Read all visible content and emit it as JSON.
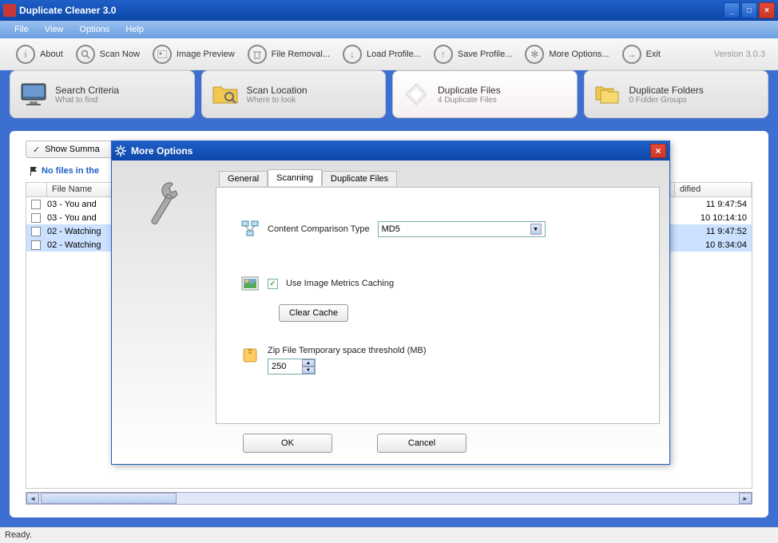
{
  "app": {
    "title": "Duplicate Cleaner 3.0",
    "version": "Version 3.0.3"
  },
  "menu": [
    "File",
    "View",
    "Options",
    "Help"
  ],
  "toolbar": [
    {
      "label": "About",
      "icon": "i"
    },
    {
      "label": "Scan Now",
      "icon": "search"
    },
    {
      "label": "Image Preview",
      "icon": "image"
    },
    {
      "label": "File Removal...",
      "icon": "trash"
    },
    {
      "label": "Load Profile...",
      "icon": "down"
    },
    {
      "label": "Save Profile...",
      "icon": "up"
    },
    {
      "label": "More Options...",
      "icon": "gear"
    },
    {
      "label": "Exit",
      "icon": "exit"
    }
  ],
  "bigtabs": [
    {
      "title": "Search Criteria",
      "sub": "What to find",
      "icon": "monitor"
    },
    {
      "title": "Scan Location",
      "sub": "Where to look",
      "icon": "folder-search"
    },
    {
      "title": "Duplicate Files",
      "sub": "4 Duplicate Files",
      "icon": "diamond",
      "active": true
    },
    {
      "title": "Duplicate Folders",
      "sub": "0 Folder Groups",
      "icon": "folders"
    }
  ],
  "summary_btn": "Show Summa",
  "no_files_text": "No files in the",
  "file_cols": {
    "name": "File Name",
    "modified": "dified"
  },
  "files": [
    {
      "name": "03 - You and",
      "modified": "11 9:47:54",
      "sel": false
    },
    {
      "name": "03 - You and",
      "modified": "10 10:14:10",
      "sel": false
    },
    {
      "name": "02 - Watching",
      "modified": "11 9:47:52",
      "sel": true
    },
    {
      "name": "02 - Watching",
      "modified": "10 8:34:04",
      "sel": true
    }
  ],
  "status": "Ready.",
  "dialog": {
    "title": "More Options",
    "tabs": [
      "General",
      "Scanning",
      "Duplicate Files"
    ],
    "active_tab": "Scanning",
    "content_compare_label": "Content Comparison Type",
    "content_compare_value": "MD5",
    "use_image_cache_label": "Use Image Metrics Caching",
    "use_image_cache_checked": true,
    "clear_cache_btn": "Clear Cache",
    "zip_threshold_label": "Zip File Temporary space threshold (MB)",
    "zip_threshold_value": "250",
    "ok": "OK",
    "cancel": "Cancel"
  }
}
